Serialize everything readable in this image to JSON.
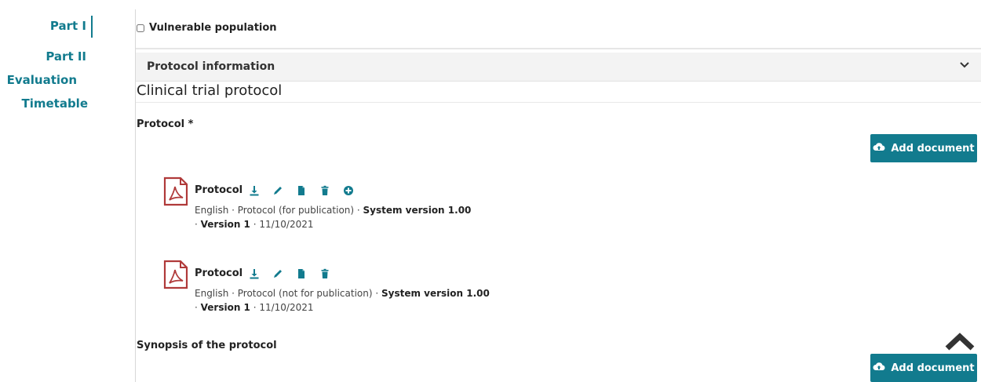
{
  "nav": {
    "items": [
      {
        "label": "Part I",
        "active": true
      },
      {
        "label": "Part II",
        "active": false
      },
      {
        "label": "Evaluation",
        "active": false
      },
      {
        "label": "Timetable",
        "active": false
      }
    ]
  },
  "vulnerable": {
    "label": "Vulnerable population",
    "checked": false
  },
  "accordion": {
    "title": "Protocol information",
    "icon": "chevron-down-icon"
  },
  "section": {
    "title": "Clinical trial protocol"
  },
  "protocol_field": {
    "label": "Protocol *"
  },
  "add_document_label": "Add document",
  "documents": [
    {
      "name": "Protocol",
      "actions": [
        "download-icon",
        "edit-icon",
        "file-icon",
        "delete-icon",
        "add-circle-icon"
      ],
      "meta_line1_prefix": "English · Protocol (for publication) · ",
      "meta_line1_bold": "System version 1.00",
      "meta_line2_prefix": "· ",
      "meta_line2_bold": "Version 1",
      "meta_line2_suffix": " · 11/10/2021"
    },
    {
      "name": "Protocol",
      "actions": [
        "download-icon",
        "edit-icon",
        "file-icon",
        "delete-icon"
      ],
      "meta_line1_prefix": "English · Protocol (not for publication) · ",
      "meta_line1_bold": "System version 1.00",
      "meta_line2_prefix": "· ",
      "meta_line2_bold": "Version 1",
      "meta_line2_suffix": " · 11/10/2021"
    }
  ],
  "synopsis_field": {
    "label": "Synopsis of the protocol"
  },
  "colors": {
    "accent": "#127b8e",
    "pdf": "#b03a3a"
  }
}
